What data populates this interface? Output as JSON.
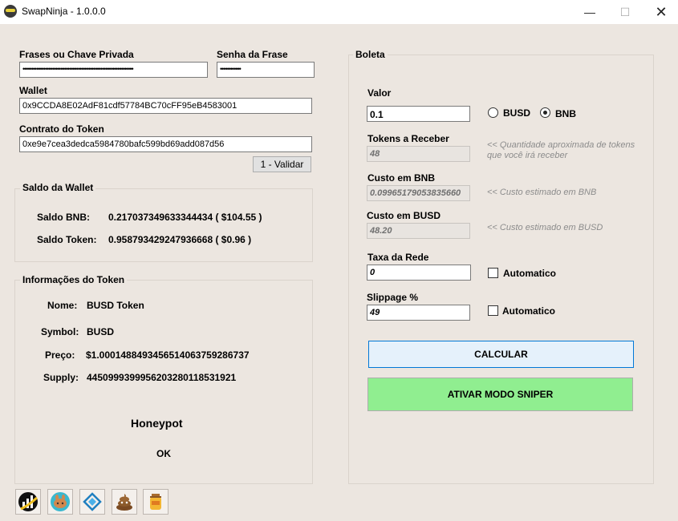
{
  "window": {
    "title": "SwapNinja - 1.0.0.0",
    "minimize": "—",
    "maximize": "☐",
    "close": "✕"
  },
  "left": {
    "phrase_label": "Frases ou Chave Privada",
    "phrase_value": "••••••••••••••••••••••••••••••••••••••••••••••••••••••••••••••••",
    "password_label": "Senha da Frase",
    "password_value": "••••••••••••",
    "wallet_label": "Wallet",
    "wallet_value": "0x9CCDA8E02AdF81cdf57784BC70cFF95eB4583001",
    "contract_label": "Contrato do Token",
    "contract_value": "0xe9e7cea3dedca5984780bafc599bd69add087d56",
    "validate_button": "1 - Validar",
    "balance_group": "Saldo da Wallet",
    "bnb_balance_label": "Saldo BNB:",
    "bnb_balance_value": "0.21703734963334443​4 ( $104.55 )",
    "token_balance_label": "Saldo Token:",
    "token_balance_value": "0.958793429247936668 ( $0.96 )",
    "info_group": "Informações do Token",
    "name_label": "Nome:",
    "name_value": "BUSD Token",
    "symbol_label": "Symbol:",
    "symbol_value": "BUSD",
    "price_label": "Preço:",
    "price_value": "$1.00014884934565140637592867​37",
    "supply_label": "Supply:",
    "supply_value": "4450999399956203280118531921",
    "honeypot_label": "Honeypot",
    "honeypot_status": "OK"
  },
  "right": {
    "group": "Boleta",
    "valor_label": "Valor",
    "valor_value": "0.1",
    "radio_busd": "BUSD",
    "radio_bnb": "BNB",
    "selected_currency": "BNB",
    "tokens_label": "Tokens a Receber",
    "tokens_value": "48",
    "tokens_hint": "<< Quantidade aproximada de tokens que você irá receber",
    "cost_bnb_label": "Custo em BNB",
    "cost_bnb_value": "0.09965179053835660",
    "cost_bnb_hint": "<< Custo estimado em BNB",
    "cost_busd_label": "Custo em BUSD",
    "cost_busd_value": "48.20",
    "cost_busd_hint": "<< Custo estimado em BUSD",
    "fee_label": "Taxa da Rede",
    "fee_value": "0",
    "fee_auto": "Automatico",
    "slippage_label": "Slippage %",
    "slippage_value": "49",
    "slippage_auto": "Automatico",
    "calculate_button": "CALCULAR",
    "sniper_button": "ATIVAR MODO SNIPER"
  },
  "colors": {
    "background": "#ece6e0",
    "calc_button_bg": "#e5f1fb",
    "calc_button_border": "#0078d7",
    "sniper_button_bg": "#90ee90"
  },
  "bottom_icons": [
    "chart-app-icon",
    "pancakeswap-bunny-icon",
    "bsc-chain-icon",
    "poocoin-icon",
    "honeypot-jar-icon"
  ]
}
